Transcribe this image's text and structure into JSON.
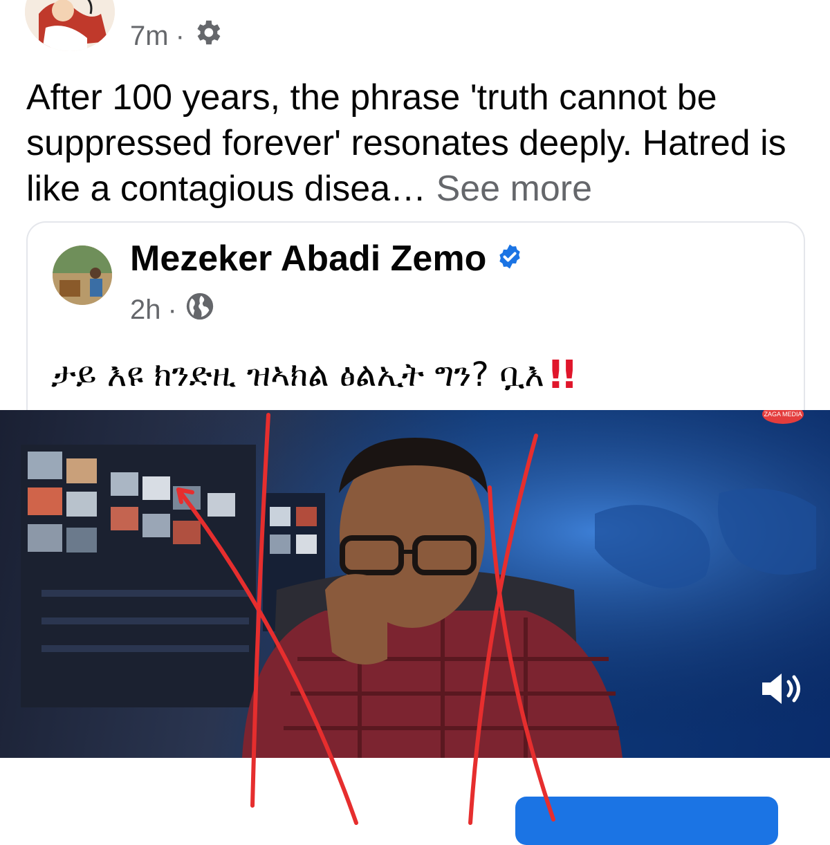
{
  "post": {
    "time": "7m",
    "separator": "·",
    "privacy_icon": "gear-icon",
    "text": "After 100 years, the phrase 'truth cannot be suppressed forever' resonates deeply. Hatred is like a contagious disea… ",
    "see_more": "See more"
  },
  "shared_post": {
    "author": "Mezeker Abadi Zemo",
    "verified_icon": "verified-badge-icon",
    "time": "2h",
    "separator": "·",
    "privacy_icon": "globe-icon",
    "text": "ታይ እዩ ክንድዚ ዝኣክል ፅልኢት ግን? ቧእ",
    "emphasis": "!!"
  },
  "video": {
    "volume_icon": "volume-icon",
    "channel_logo": "ZAGA MEDIA"
  },
  "colors": {
    "accent": "#1b74e4",
    "annotation": "#e62e2e",
    "meta": "#65676b"
  }
}
